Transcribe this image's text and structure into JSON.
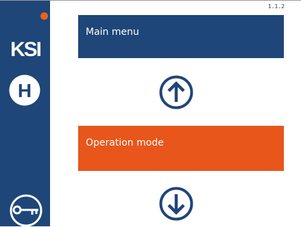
{
  "header": {
    "version": "1.1.2"
  },
  "sidebar": {
    "logo_text": "KSI",
    "status_color": "#e8601c",
    "home_label": "H",
    "icons": [
      "status-dot",
      "home-icon",
      "key-icon"
    ],
    "bg_color": "#1e4678"
  },
  "menu": {
    "main_label": "Main menu",
    "operation_label": "Operation mode",
    "main_color": "#1e4678",
    "operation_color": "#e8561c",
    "nav_icons": [
      "arrow-up-icon",
      "arrow-down-icon"
    ]
  }
}
